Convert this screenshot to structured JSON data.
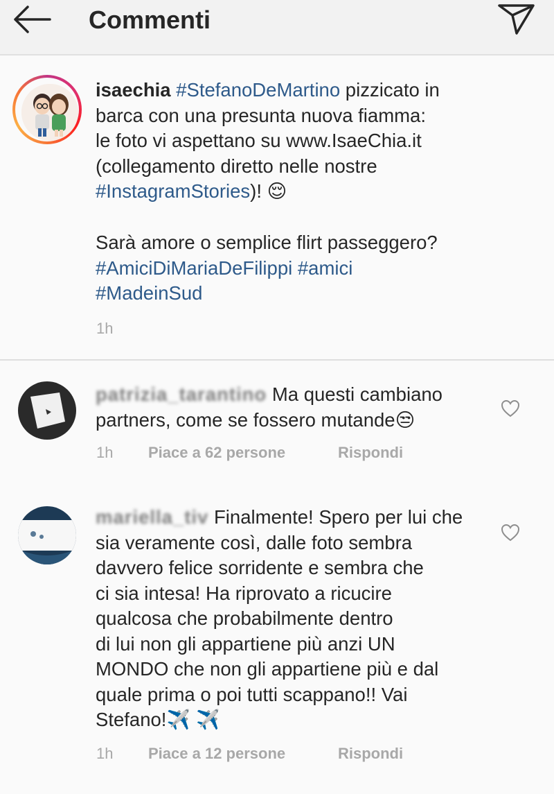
{
  "header": {
    "title": "Commenti"
  },
  "caption": {
    "username": "isaechia",
    "hashtag_1": "#StefanoDeMartino",
    "text_1": " pizzicato in\nbarca con una presunta nuova fiamma:\nle foto vi aspettano su www.IsaeChia.it\n(collegamento diretto nelle nostre\n",
    "hashtag_2": "#InstagramStories",
    "text_2": ")! ",
    "emoji_1": "😌",
    "text_3": "Sarà amore o semplice flirt passeggero?",
    "hashtag_3": "#AmiciDiMariaDeFilippi",
    "hashtag_4": "#amici",
    "hashtag_5": "#MadeinSud",
    "time": "1h"
  },
  "comments": [
    {
      "username_obscured": "patrizia_tarantino",
      "text_1": "Ma questi cambiano\npartners, come se fossero mutande",
      "emoji": "😒",
      "time": "1h",
      "likes": "Piace a 62 persone",
      "reply": "Rispondi"
    },
    {
      "username_obscured": "mariella_tiv",
      "text_1": "Finalmente! Spero per lui che\nsia veramente così, dalle foto sembra\ndavvero felice sorridente e sembra che\nci sia intesa! Ha riprovato a ricucire\nqualcosa che probabilmente dentro\ndi lui non gli appartiene più anzi UN\nMONDO che non gli appartiene più e dal\nquale prima o poi tutti scappano!! Vai\nStefano!",
      "emoji": "✈️ ✈️",
      "time": "1h",
      "likes": "Piace a 12 persone",
      "reply": "Rispondi"
    }
  ],
  "icons": {
    "back": "arrow-left-icon",
    "send": "paper-plane-icon",
    "like": "heart-outline-icon"
  },
  "colors": {
    "hashtag": "#2e5a8a",
    "meta": "#a8a8a8",
    "text": "#262626"
  }
}
